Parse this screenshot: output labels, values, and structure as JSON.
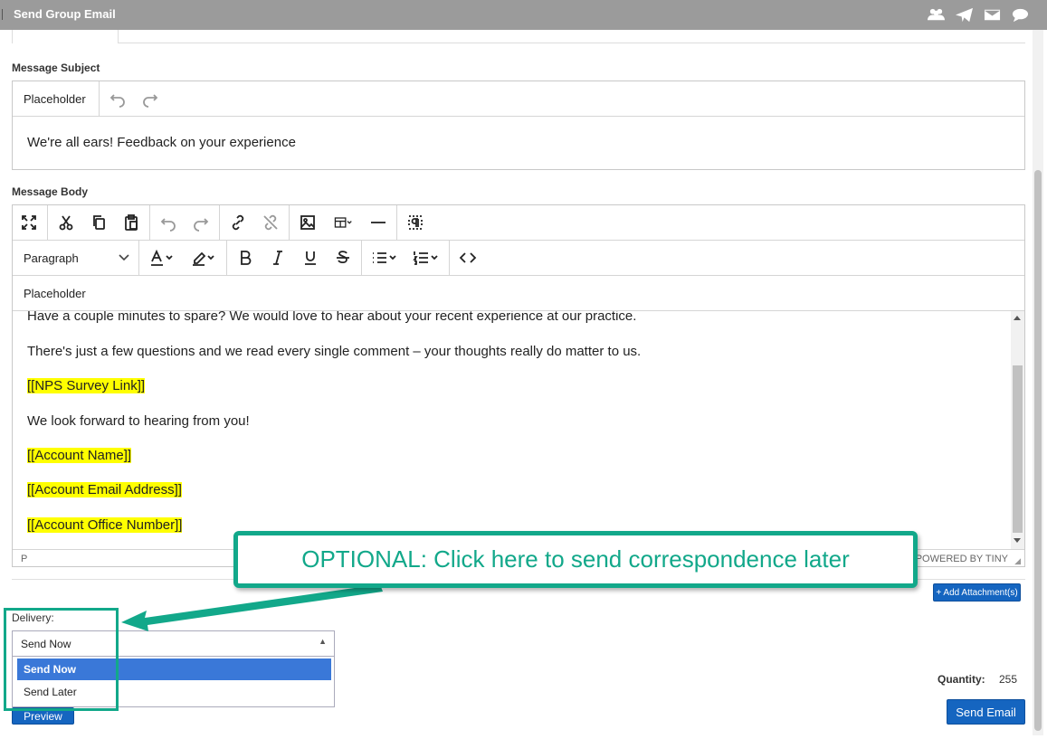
{
  "window": {
    "title": "Send Group Email",
    "icons": [
      "users-icon",
      "paper-plane-icon",
      "envelope-icon",
      "comment-icon"
    ]
  },
  "subject": {
    "label": "Message Subject",
    "placeholder_btn": "Placeholder",
    "value": "We're all ears! Feedback on your experience"
  },
  "body": {
    "label": "Message Body",
    "block_format": "Paragraph",
    "placeholder_btn": "Placeholder",
    "paragraphs": [
      "Have a couple minutes to spare? We would love to hear about your recent experience at our practice.",
      "There's just a few questions and we read every single comment – your thoughts really do matter to us.",
      "[[NPS Survey Link]]",
      "We look forward to hearing from you!",
      "[[Account Name]]",
      "[[Account Email Address]]",
      "[[Account Office Number]]"
    ],
    "status_path": "P",
    "powered": "POWERED BY TINY"
  },
  "attachments_btn": "+ Add Attachment(s)",
  "delivery": {
    "label": "Delivery:",
    "selected": "Send Now",
    "options": [
      "Send Now",
      "Send Later"
    ]
  },
  "preview_btn": "Preview",
  "quantity": {
    "label": "Quantity:",
    "value": "255"
  },
  "send_btn": "Send Email",
  "callout_text": "OPTIONAL: Click here to send  correspondence later",
  "colors": {
    "accent_green": "#12a88a",
    "button_blue": "#1565c0",
    "highlight": "#ffff00",
    "selected_option": "#3a78d8"
  }
}
